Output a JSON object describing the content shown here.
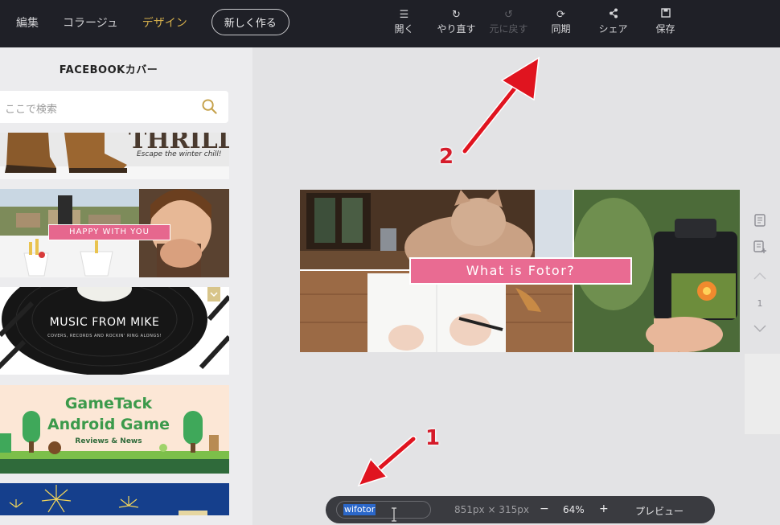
{
  "topnav": {
    "items": [
      "編集",
      "コラージュ",
      "デザイン"
    ],
    "new_button": "新しく作る"
  },
  "toolbar": {
    "items": [
      {
        "icon": "menu-icon",
        "label": "開く",
        "enabled": true
      },
      {
        "icon": "redo-icon",
        "label": "やり直す",
        "enabled": true
      },
      {
        "icon": "undo-icon",
        "label": "元に戻す",
        "enabled": false
      },
      {
        "icon": "sync-icon",
        "label": "同期",
        "enabled": true
      },
      {
        "icon": "share-icon",
        "label": "シェア",
        "enabled": true
      },
      {
        "icon": "save-icon",
        "label": "保存",
        "enabled": true
      }
    ]
  },
  "sidebar": {
    "title": "FACEBOOKカバー",
    "search_placeholder": "ここで検索",
    "templates": [
      {
        "title": "THRILL!",
        "subtitle": "Escape the winter chill!"
      },
      {
        "title": "HAPPY WITH YOU"
      },
      {
        "title": "MUSIC FROM MIKE",
        "subtitle": "COVERS, RECORDS AND ROCKIN' RING ALONGS!"
      },
      {
        "title": "GameTack",
        "title2": "Android Game",
        "subtitle": "Reviews & News"
      },
      {
        "title": ""
      }
    ]
  },
  "canvas": {
    "cover_label": "What is Fotor?",
    "page_number": "1"
  },
  "bottombar": {
    "file_name": "wifotor",
    "dimensions": "851px × 315px",
    "zoom_minus": "−",
    "zoom": "64%",
    "zoom_plus": "+",
    "preview": "プレビュー"
  },
  "annotations": {
    "num1": "1",
    "num2": "2"
  },
  "colors": {
    "accent": "#d2ad4b",
    "topbar": "#1f2027",
    "pink": "#e96b92",
    "arrow": "#e0141f"
  }
}
